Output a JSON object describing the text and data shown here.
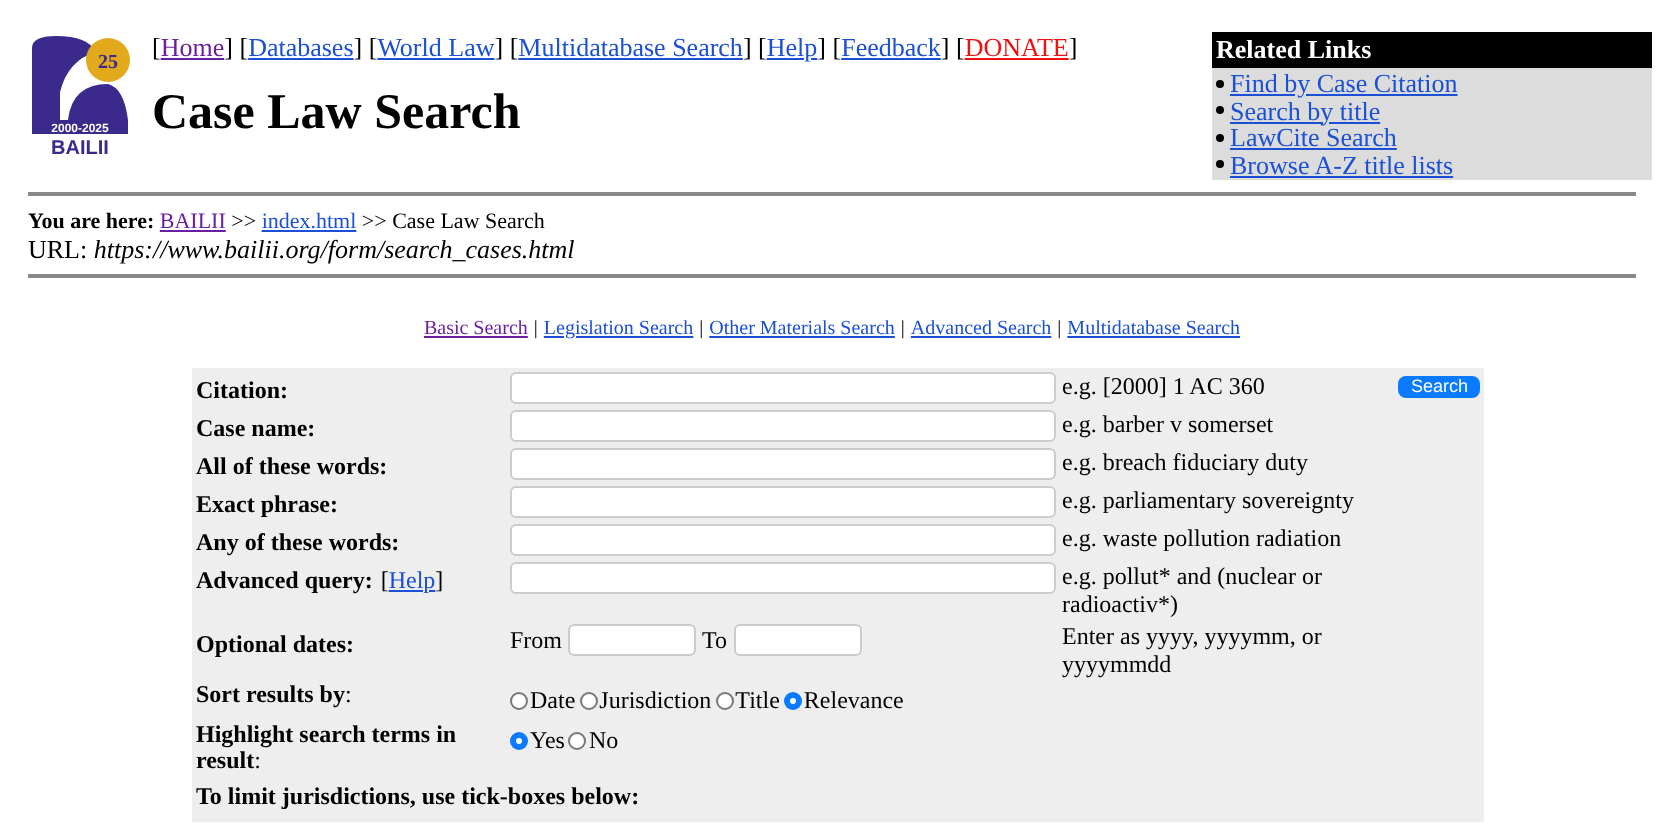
{
  "logo": {
    "badge": "25",
    "years": "2000-2025",
    "name": "BAILII"
  },
  "nav": [
    {
      "open": "[",
      "label": "Home",
      "close": "]",
      "kind": "visited"
    },
    {
      "open": "[",
      "label": "Databases",
      "close": "]",
      "kind": "link"
    },
    {
      "open": "[",
      "label": "World Law",
      "close": "]",
      "kind": "link"
    },
    {
      "open": "[",
      "label": "Multidatabase Search",
      "close": "]",
      "kind": "link"
    },
    {
      "open": "[",
      "label": "Help",
      "close": "]",
      "kind": "link"
    },
    {
      "open": "[",
      "label": "Feedback",
      "close": "]",
      "kind": "link"
    },
    {
      "open": "[",
      "label": "DONATE",
      "close": "]",
      "kind": "donate"
    }
  ],
  "search_type_separator": "|",
  "title": "Case Law Search",
  "related_links": {
    "title": "Related Links",
    "items": [
      "Find by Case Citation",
      "Search by title",
      "LawCite Search",
      "Browse A-Z title lists"
    ]
  },
  "breadcrumb": {
    "label": "You are here:",
    "items": [
      {
        "text": "BAILII",
        "kind": "visited"
      },
      {
        "text": ">>",
        "kind": "text"
      },
      {
        "text": "index.html",
        "kind": "link"
      },
      {
        "text": ">> Case Law Search",
        "kind": "text"
      }
    ]
  },
  "url": {
    "label": "URL:",
    "value": "https://www.bailii.org/form/search_cases.html"
  },
  "search_types": [
    {
      "label": "Basic Search",
      "selected": true
    },
    {
      "label": "Legislation Search",
      "selected": false
    },
    {
      "label": "Other Materials Search",
      "selected": false
    },
    {
      "label": "Advanced Search",
      "selected": false
    },
    {
      "label": "Multidatabase Search",
      "selected": false
    }
  ],
  "search_button": "Search",
  "form_rows": [
    {
      "kind": "text",
      "label": "Citation:",
      "hint": "e.g. [2000] 1 AC 360"
    },
    {
      "kind": "text",
      "label": "Case name:",
      "hint": "e.g. barber v somerset"
    },
    {
      "kind": "text",
      "label": "All of these words:",
      "hint": "e.g. breach fiduciary duty"
    },
    {
      "kind": "text",
      "label": "Exact phrase:",
      "hint": "e.g. parliamentary sovereignty"
    },
    {
      "kind": "text",
      "label": "Any of these words:",
      "hint": "e.g. waste pollution radiation"
    },
    {
      "kind": "text",
      "label": "Advanced query:",
      "help": {
        "open": "[",
        "label": "Help",
        "close": "]"
      },
      "hint": "e.g. pollut* and (nuclear or radioactiv*)"
    },
    {
      "kind": "dates",
      "label": "Optional dates:",
      "from": "From",
      "to": "To",
      "hint": "Enter as yyyy, yyyymm, or yyyymmdd"
    },
    {
      "kind": "radio",
      "label": "Sort results by",
      "suffix": ":",
      "options": [
        {
          "label": "Date",
          "selected": false
        },
        {
          "label": "Jurisdiction",
          "selected": false
        },
        {
          "label": "Title",
          "selected": false
        },
        {
          "label": "Relevance",
          "selected": true
        }
      ]
    },
    {
      "kind": "radio",
      "label": "Highlight search terms in result",
      "suffix": ":",
      "options": [
        {
          "label": "Yes",
          "selected": true
        },
        {
          "label": "No",
          "selected": false
        }
      ]
    },
    {
      "kind": "note",
      "label": "To limit jurisdictions, use tick-boxes below:"
    }
  ]
}
